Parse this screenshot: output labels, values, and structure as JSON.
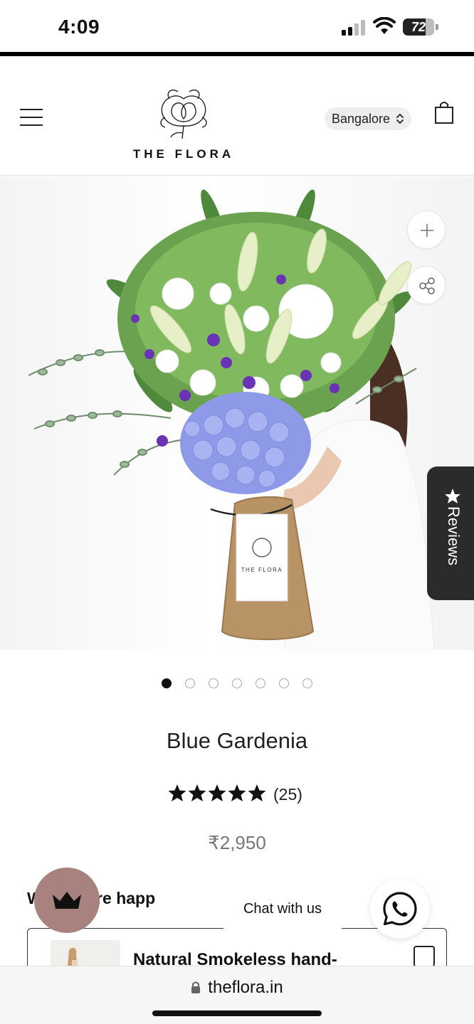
{
  "status_bar": {
    "time": "4:09",
    "battery": "72",
    "battery_level": 0.72
  },
  "header": {
    "brand": "THE FLORA",
    "city": "Bangalore"
  },
  "hero": {
    "tag_brand": "THE FLORA",
    "reviews_label": "Reviews",
    "slide_count": 7,
    "active_slide": 1
  },
  "product": {
    "title": "Blue Gardenia",
    "rating": 5,
    "review_count": "(25)",
    "price": "₹2,950"
  },
  "addons": {
    "heading": "W dd more happ",
    "items": [
      {
        "name": "Natural Smokeless hand-"
      }
    ]
  },
  "chat": {
    "label": "Chat with us"
  },
  "browser": {
    "url": "theflora.in"
  },
  "colors": {
    "reviews_tab": "#2b2b2b",
    "loyalty_button": "#a8827f",
    "accent_dark": "#111111"
  },
  "icons": {
    "menu": "hamburger-icon",
    "cart": "shopping-bag-icon",
    "zoom": "plus-icon",
    "share": "share-icon",
    "reviews": "star-icon",
    "loyalty": "crown-icon",
    "chat": "whatsapp-icon",
    "lock": "lock-icon"
  }
}
